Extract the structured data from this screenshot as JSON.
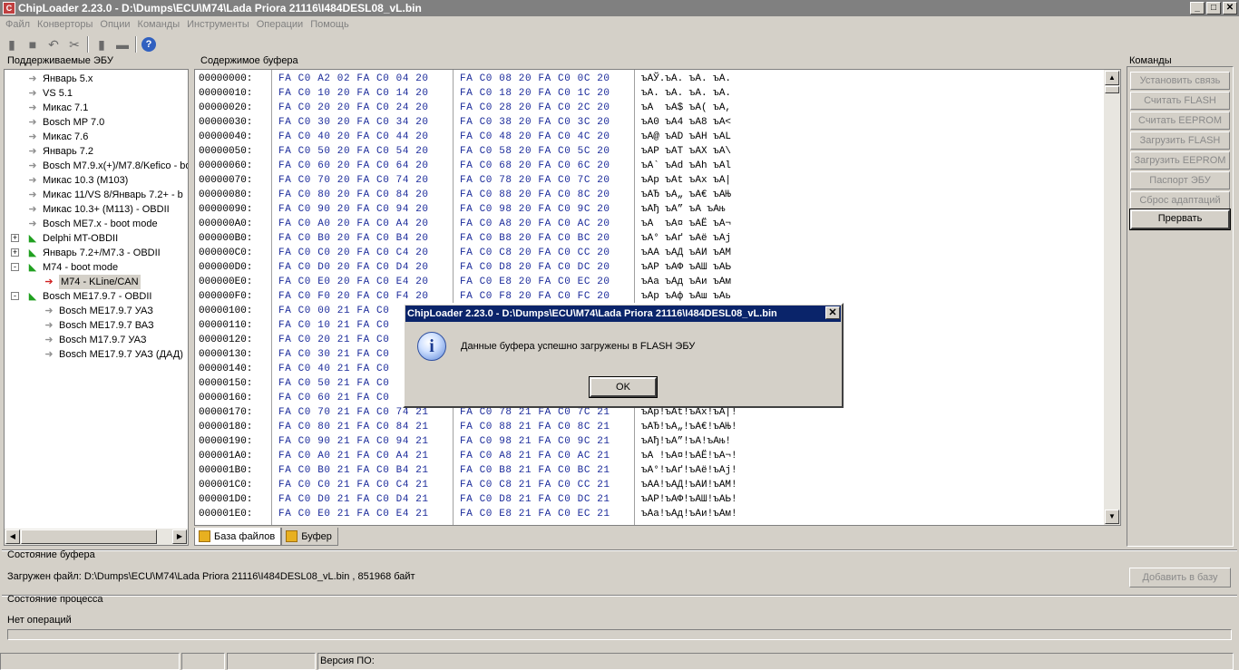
{
  "window": {
    "title": "ChipLoader 2.23.0 - D:\\Dumps\\ECU\\M74\\Lada Priora 21116\\I484DESL08_vL.bin"
  },
  "menu": [
    "Файл",
    "Конверторы",
    "Опции",
    "Команды",
    "Инструменты",
    "Операции",
    "Помощь"
  ],
  "panels": {
    "ecu_label": "Поддерживаемые ЭБУ",
    "buffer_label": "Содержимое буфера",
    "commands_label": "Команды",
    "buffer_state_label": "Состояние буфера",
    "process_state_label": "Состояние процесса"
  },
  "tree": [
    {
      "label": "Январь 5.х",
      "icon": "gray"
    },
    {
      "label": "VS 5.1",
      "icon": "gray"
    },
    {
      "label": "Микас 7.1",
      "icon": "gray"
    },
    {
      "label": "Bosch MP 7.0",
      "icon": "gray"
    },
    {
      "label": "Микас 7.6",
      "icon": "gray"
    },
    {
      "label": "Январь 7.2",
      "icon": "gray"
    },
    {
      "label": "Bosch M7.9.x(+)/M7.8/Kefico - bo",
      "icon": "gray"
    },
    {
      "label": "Микас 10.3 (M103)",
      "icon": "gray"
    },
    {
      "label": "Микас 11/VS 8/Январь 7.2+ - b",
      "icon": "gray"
    },
    {
      "label": "Микас 10.3+ (M113) - OBDII",
      "icon": "gray"
    },
    {
      "label": "Bosch ME7.x - boot mode",
      "icon": "gray"
    },
    {
      "label": "Delphi MT-OBDII",
      "icon": "green",
      "expander": "+"
    },
    {
      "label": "Январь 7.2+/M7.3 - OBDII",
      "icon": "green",
      "expander": "+"
    },
    {
      "label": "M74 - boot mode",
      "icon": "green",
      "expander": "-"
    },
    {
      "label": "M74 - KLine/CAN",
      "icon": "red",
      "child": true,
      "selected": true
    },
    {
      "label": "Bosch ME17.9.7 - OBDII",
      "icon": "green",
      "expander": "-"
    },
    {
      "label": "Bosch ME17.9.7 УАЗ",
      "icon": "gray",
      "child": true
    },
    {
      "label": "Bosch ME17.9.7 ВАЗ",
      "icon": "gray",
      "child": true
    },
    {
      "label": "Bosch M17.9.7 УАЗ",
      "icon": "gray",
      "child": true
    },
    {
      "label": "Bosch ME17.9.7 УАЗ (ДАД)",
      "icon": "gray",
      "child": true
    }
  ],
  "hex": [
    {
      "addr": "00000000:",
      "b1": "FA C0 A2 02 FA C0 04 20",
      "b2": "FA C0 08 20 FA C0 0C 20",
      "asc": "ъАЎ.ъА. ъА. ъА."
    },
    {
      "addr": "00000010:",
      "b1": "FA C0 10 20 FA C0 14 20",
      "b2": "FA C0 18 20 FA C0 1C 20",
      "asc": "ъА. ъА. ъА. ъА."
    },
    {
      "addr": "00000020:",
      "b1": "FA C0 20 20 FA C0 24 20",
      "b2": "FA C0 28 20 FA C0 2C 20",
      "asc": "ъА  ъА$ ъА( ъА,"
    },
    {
      "addr": "00000030:",
      "b1": "FA C0 30 20 FA C0 34 20",
      "b2": "FA C0 38 20 FA C0 3C 20",
      "asc": "ъА0 ъА4 ъА8 ъА<"
    },
    {
      "addr": "00000040:",
      "b1": "FA C0 40 20 FA C0 44 20",
      "b2": "FA C0 48 20 FA C0 4C 20",
      "asc": "ъА@ ъАD ъАH ъАL"
    },
    {
      "addr": "00000050:",
      "b1": "FA C0 50 20 FA C0 54 20",
      "b2": "FA C0 58 20 FA C0 5C 20",
      "asc": "ъАP ъАT ъАX ъА\\"
    },
    {
      "addr": "00000060:",
      "b1": "FA C0 60 20 FA C0 64 20",
      "b2": "FA C0 68 20 FA C0 6C 20",
      "asc": "ъА` ъАd ъАh ъАl"
    },
    {
      "addr": "00000070:",
      "b1": "FA C0 70 20 FA C0 74 20",
      "b2": "FA C0 78 20 FA C0 7C 20",
      "asc": "ъАp ъАt ъАx ъА|"
    },
    {
      "addr": "00000080:",
      "b1": "FA C0 80 20 FA C0 84 20",
      "b2": "FA C0 88 20 FA C0 8C 20",
      "asc": "ъАЂ ъА„ ъА€ ъАЊ"
    },
    {
      "addr": "00000090:",
      "b1": "FA C0 90 20 FA C0 94 20",
      "b2": "FA C0 98 20 FA C0 9C 20",
      "asc": "ъАђ ъА” ъА ъАњ"
    },
    {
      "addr": "000000A0:",
      "b1": "FA C0 A0 20 FA C0 A4 20",
      "b2": "FA C0 A8 20 FA C0 AC 20",
      "asc": "ъА  ъА¤ ъАЁ ъА¬"
    },
    {
      "addr": "000000B0:",
      "b1": "FA C0 B0 20 FA C0 B4 20",
      "b2": "FA C0 B8 20 FA C0 BC 20",
      "asc": "ъА° ъАґ ъАё ъАј"
    },
    {
      "addr": "000000C0:",
      "b1": "FA C0 C0 20 FA C0 C4 20",
      "b2": "FA C0 C8 20 FA C0 CC 20",
      "asc": "ъАА ъАД ъАИ ъАМ"
    },
    {
      "addr": "000000D0:",
      "b1": "FA C0 D0 20 FA C0 D4 20",
      "b2": "FA C0 D8 20 FA C0 DC 20",
      "asc": "ъАР ъАФ ъАШ ъАЬ"
    },
    {
      "addr": "000000E0:",
      "b1": "FA C0 E0 20 FA C0 E4 20",
      "b2": "FA C0 E8 20 FA C0 EC 20",
      "asc": "ъАа ъАд ъАи ъАм"
    },
    {
      "addr": "000000F0:",
      "b1": "FA C0 F0 20 FA C0 F4 20",
      "b2": "FA C0 F8 20 FA C0 FC 20",
      "asc": "ъАр ъАф ъАш ъАь"
    },
    {
      "addr": "00000100:",
      "b1": "FA C0 00 21 FA C0",
      "b2": "",
      "asc": ""
    },
    {
      "addr": "00000110:",
      "b1": "FA C0 10 21 FA C0",
      "b2": "",
      "asc": ""
    },
    {
      "addr": "00000120:",
      "b1": "FA C0 20 21 FA C0",
      "b2": "",
      "asc": ""
    },
    {
      "addr": "00000130:",
      "b1": "FA C0 30 21 FA C0",
      "b2": "",
      "asc": ""
    },
    {
      "addr": "00000140:",
      "b1": "FA C0 40 21 FA C0",
      "b2": "",
      "asc": ""
    },
    {
      "addr": "00000150:",
      "b1": "FA C0 50 21 FA C0",
      "b2": "",
      "asc": ""
    },
    {
      "addr": "00000160:",
      "b1": "FA C0 60 21 FA C0",
      "b2": "",
      "asc": ""
    },
    {
      "addr": "00000170:",
      "b1": "FA C0 70 21 FA C0 74 21",
      "b2": "FA C0 78 21 FA C0 7C 21",
      "asc": "ъАp!ъАt!ъАx!ъА|!"
    },
    {
      "addr": "00000180:",
      "b1": "FA C0 80 21 FA C0 84 21",
      "b2": "FA C0 88 21 FA C0 8C 21",
      "asc": "ъАЂ!ъА„!ъА€!ъАЊ!"
    },
    {
      "addr": "00000190:",
      "b1": "FA C0 90 21 FA C0 94 21",
      "b2": "FA C0 98 21 FA C0 9C 21",
      "asc": "ъАђ!ъА”!ъА!ъАњ!"
    },
    {
      "addr": "000001A0:",
      "b1": "FA C0 A0 21 FA C0 A4 21",
      "b2": "FA C0 A8 21 FA C0 AC 21",
      "asc": "ъА !ъА¤!ъАЁ!ъА¬!"
    },
    {
      "addr": "000001B0:",
      "b1": "FA C0 B0 21 FA C0 B4 21",
      "b2": "FA C0 B8 21 FA C0 BC 21",
      "asc": "ъА°!ъАґ!ъАё!ъАј!"
    },
    {
      "addr": "000001C0:",
      "b1": "FA C0 C0 21 FA C0 C4 21",
      "b2": "FA C0 C8 21 FA C0 CC 21",
      "asc": "ъАА!ъАД!ъАИ!ъАМ!"
    },
    {
      "addr": "000001D0:",
      "b1": "FA C0 D0 21 FA C0 D4 21",
      "b2": "FA C0 D8 21 FA C0 DC 21",
      "asc": "ъАР!ъАФ!ъАШ!ъАЬ!"
    },
    {
      "addr": "000001E0:",
      "b1": "FA C0 E0 21 FA C0 E4 21",
      "b2": "FA C0 E8 21 FA C0 EC 21",
      "asc": "ъАа!ъАд!ъАи!ъАм!"
    }
  ],
  "tabs": [
    {
      "label": "База файлов",
      "active": true
    },
    {
      "label": "Буфер",
      "active": false
    }
  ],
  "commands": [
    {
      "label": "Установить связь",
      "enabled": false
    },
    {
      "label": "Считать FLASH",
      "enabled": false
    },
    {
      "label": "Считать EEPROM",
      "enabled": false
    },
    {
      "label": "Загрузить FLASH",
      "enabled": false
    },
    {
      "label": "Загрузить EEPROM",
      "enabled": false
    },
    {
      "label": "Паспорт ЭБУ",
      "enabled": false
    },
    {
      "label": "Сброс адаптаций",
      "enabled": false
    },
    {
      "label": "Прервать",
      "enabled": true
    }
  ],
  "buffer_state": {
    "text": "Загружен файл: D:\\Dumps\\ECU\\M74\\Lada Priora 21116\\I484DESL08_vL.bin , 851968 байт",
    "add_button": "Добавить в базу"
  },
  "process_state": {
    "text": "Нет операций"
  },
  "statusbar": {
    "version": "Версия ПО:"
  },
  "dialog": {
    "title": "ChipLoader 2.23.0 - D:\\Dumps\\ECU\\M74\\Lada Priora 21116\\I484DESL08_vL.bin",
    "message": "Данные буфера успешно загружены в FLASH ЭБУ",
    "ok": "OK",
    "icon_glyph": "i",
    "icon": "info-icon"
  },
  "glyphs": {
    "close": "✕",
    "minimize": "_",
    "maximize": "□",
    "app": "C"
  }
}
